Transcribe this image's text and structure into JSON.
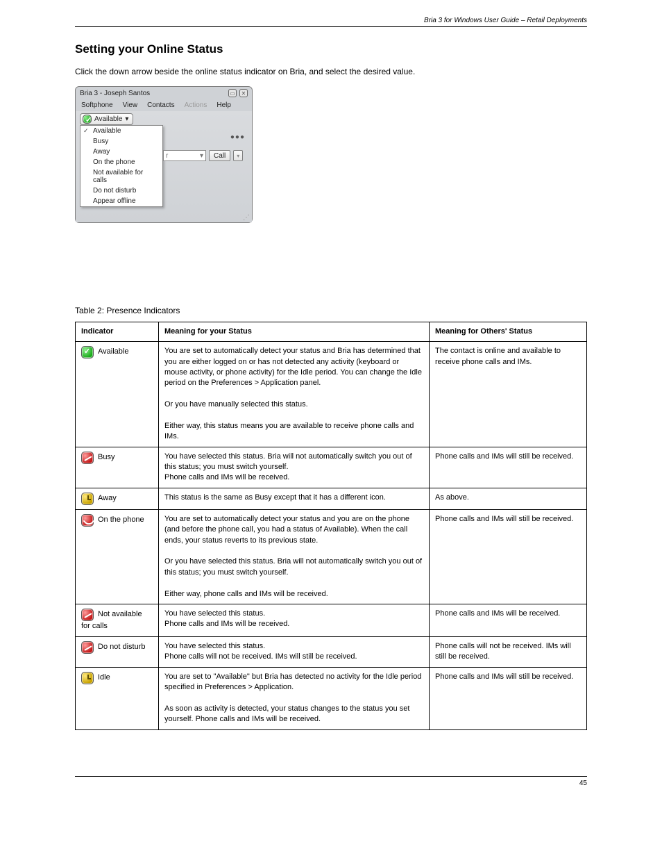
{
  "header": {
    "doc_title": "Bria 3 for Windows User Guide – Retail Deployments"
  },
  "section": {
    "title": "Setting your Online Status",
    "para1": "Click the down arrow beside the online status indicator on Bria, and select the desired value.",
    "tableLeadIn": "Table 2: Presence Indicators"
  },
  "bria": {
    "windowTitle": "Bria 3 - Joseph Santos",
    "menus": {
      "softphone": "Softphone",
      "view": "View",
      "contacts": "Contacts",
      "actions": "Actions",
      "help": "Help"
    },
    "availBtn": "Available",
    "dropdown": [
      "Available",
      "Busy",
      "Away",
      "On the phone",
      "Not available for calls",
      "Do not disturb",
      "Appear offline"
    ],
    "entryText": "r",
    "callBtn": "Call"
  },
  "table": {
    "headers": {
      "icon": "Indicator",
      "meaning": "Meaning for your Status",
      "meaning2": "Meaning for Others' Status"
    },
    "rows": [
      {
        "iconClass": "chip chip-green",
        "iconLabel": "Available",
        "meaning": "You are set to automatically detect your status and Bria has determined that you are either logged on or has not detected any activity (keyboard or mouse activity, or phone activity) for the Idle period. You can change the Idle period on the Preferences > Application panel.\n\nOr you have manually selected this status.\n\nEither way, this status means you are available to receive phone calls and IMs.",
        "meaning2": "The contact is online and available to receive phone calls and IMs."
      },
      {
        "iconClass": "chip chip-red slash",
        "iconLabel": "Busy",
        "meaning": "You have selected this status. Bria will not automatically switch you out of this status; you must switch yourself.\nPhone calls and IMs will be received.",
        "meaning2": "Phone calls and IMs will still be received."
      },
      {
        "iconClass": "chip chip-yellow",
        "iconLabel": "Away",
        "meaning": "This status is the same as Busy except that it has a different icon.",
        "meaning2": "As above."
      },
      {
        "iconClass": "chip chip-red phone",
        "iconLabel": "On the phone",
        "meaning": "You are set to automatically detect your status and you are on the phone (and before the phone call, you had a status of Available). When the call ends, your status reverts to its previous state.\n\nOr you have selected this status. Bria will not automatically switch you out of this status; you must switch yourself.\n\nEither way, phone calls and IMs will be received.",
        "meaning2": "Phone calls and IMs will still be received."
      },
      {
        "iconClass": "chip chip-red slash",
        "iconLabel": "Not available for calls",
        "meaning": "You have selected this status.\nPhone calls and IMs will be received.",
        "meaning2": "Phone calls and IMs will be received."
      },
      {
        "iconClass": "chip chip-red slash",
        "iconLabel": "Do not disturb",
        "meaning": "You have selected this status.\nPhone calls will not be received. IMs will still be received.",
        "meaning2": "Phone calls will not be received. IMs will still be received."
      },
      {
        "iconClass": "chip chip-yellow",
        "iconLabel": "Idle",
        "meaning": "You are set to \"Available\" but Bria has detected no activity for the Idle period specified in Preferences > Application.\n\nAs soon as activity is detected, your status changes to the status you set yourself. Phone calls and IMs will be received.",
        "meaning2": "Phone calls and IMs will still be received."
      }
    ]
  },
  "footer": {
    "page": "45"
  }
}
